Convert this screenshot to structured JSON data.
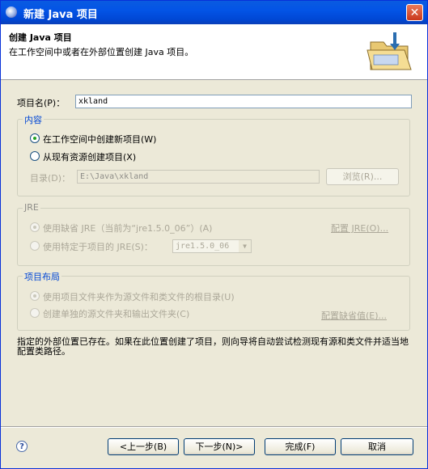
{
  "window": {
    "title": "新建 Java 项目",
    "close_label": "✕"
  },
  "header": {
    "title": "创建 Java 项目",
    "description": "在工作空间中或者在外部位置创建 Java 项目。"
  },
  "project_name": {
    "label": "项目名(P)：",
    "value": "xkland"
  },
  "contents": {
    "title": "内容",
    "option_workspace": "在工作空间中创建新项目(W)",
    "option_existing": "从现有资源创建项目(X)",
    "directory_label": "目录(D)：",
    "directory_value": "E:\\Java\\xkland",
    "browse_label": "浏览(R)..."
  },
  "jre": {
    "title": "JRE",
    "option_default": "使用缺省 JRE（当前为“jre1.5.0_06”）(A)",
    "configure_link": "配置 JRE(O)...",
    "option_specific": "使用特定于项目的 JRE(S)：",
    "selected": "jre1.5.0_06"
  },
  "layout": {
    "title": "项目布局",
    "option_root": "使用项目文件夹作为源文件和类文件的根目录(U)",
    "option_separate": "创建单独的源文件夹和输出文件夹(C)",
    "configure_link": "配置缺省值(E)..."
  },
  "info_message": "指定的外部位置已存在。如果在此位置创建了项目，则向导将自动尝试检测现有源和类文件并适当地配置类路径。",
  "buttons": {
    "help": "?",
    "back": "<上一步(B)",
    "next": "下一步(N)>",
    "finish": "完成(F)",
    "cancel": "取消"
  },
  "colors": {
    "titlebar": "#0054e3",
    "group_title": "#0046d5",
    "dialog_bg": "#ece9d8"
  }
}
